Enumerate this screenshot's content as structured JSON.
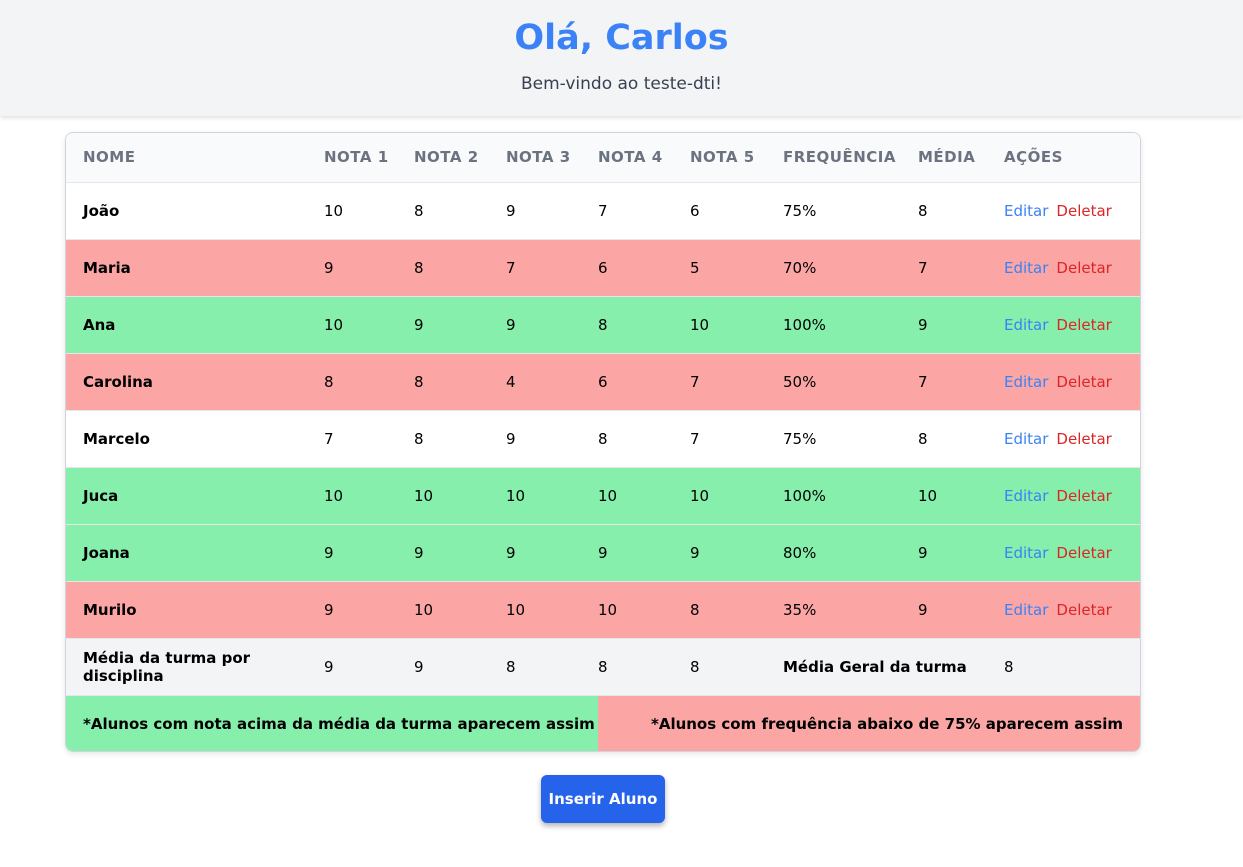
{
  "header": {
    "greeting": "Olá, Carlos",
    "subtitle": "Bem-vindo ao teste-dti!"
  },
  "table": {
    "columns": [
      "NOME",
      "NOTA 1",
      "NOTA 2",
      "NOTA 3",
      "NOTA 4",
      "NOTA 5",
      "FREQUÊNCIA",
      "MÉDIA",
      "AÇÕES"
    ],
    "rows": [
      {
        "nome": "João",
        "n1": "10",
        "n2": "8",
        "n3": "9",
        "n4": "7",
        "n5": "6",
        "freq": "75%",
        "media": "8",
        "status": "normal"
      },
      {
        "nome": "Maria",
        "n1": "9",
        "n2": "8",
        "n3": "7",
        "n4": "6",
        "n5": "5",
        "freq": "70%",
        "media": "7",
        "status": "low-frequency"
      },
      {
        "nome": "Ana",
        "n1": "10",
        "n2": "9",
        "n3": "9",
        "n4": "8",
        "n5": "10",
        "freq": "100%",
        "media": "9",
        "status": "above-average"
      },
      {
        "nome": "Carolina",
        "n1": "8",
        "n2": "8",
        "n3": "4",
        "n4": "6",
        "n5": "7",
        "freq": "50%",
        "media": "7",
        "status": "low-frequency"
      },
      {
        "nome": "Marcelo",
        "n1": "7",
        "n2": "8",
        "n3": "9",
        "n4": "8",
        "n5": "7",
        "freq": "75%",
        "media": "8",
        "status": "normal"
      },
      {
        "nome": "Juca",
        "n1": "10",
        "n2": "10",
        "n3": "10",
        "n4": "10",
        "n5": "10",
        "freq": "100%",
        "media": "10",
        "status": "above-average"
      },
      {
        "nome": "Joana",
        "n1": "9",
        "n2": "9",
        "n3": "9",
        "n4": "9",
        "n5": "9",
        "freq": "80%",
        "media": "9",
        "status": "above-average"
      },
      {
        "nome": "Murilo",
        "n1": "9",
        "n2": "10",
        "n3": "10",
        "n4": "10",
        "n5": "8",
        "freq": "35%",
        "media": "9",
        "status": "low-frequency"
      }
    ],
    "actions": {
      "edit": "Editar",
      "delete": "Deletar"
    },
    "summary": {
      "label": "Média da turma por disciplina",
      "n1": "9",
      "n2": "9",
      "n3": "8",
      "n4": "8",
      "n5": "8",
      "overall_label": "Média Geral da turma",
      "overall": "8"
    },
    "legend": {
      "above": "*Alunos com nota acima da média da turma aparecem assim",
      "low_freq": "*Alunos com frequência abaixo de 75% aparecem assim"
    }
  },
  "colors": {
    "accent": "#3b82f6",
    "above_average": "#86efac",
    "low_frequency": "#fca5a5",
    "delete": "#dc2626",
    "button": "#2563eb"
  },
  "insert_button": "Inserir Aluno"
}
